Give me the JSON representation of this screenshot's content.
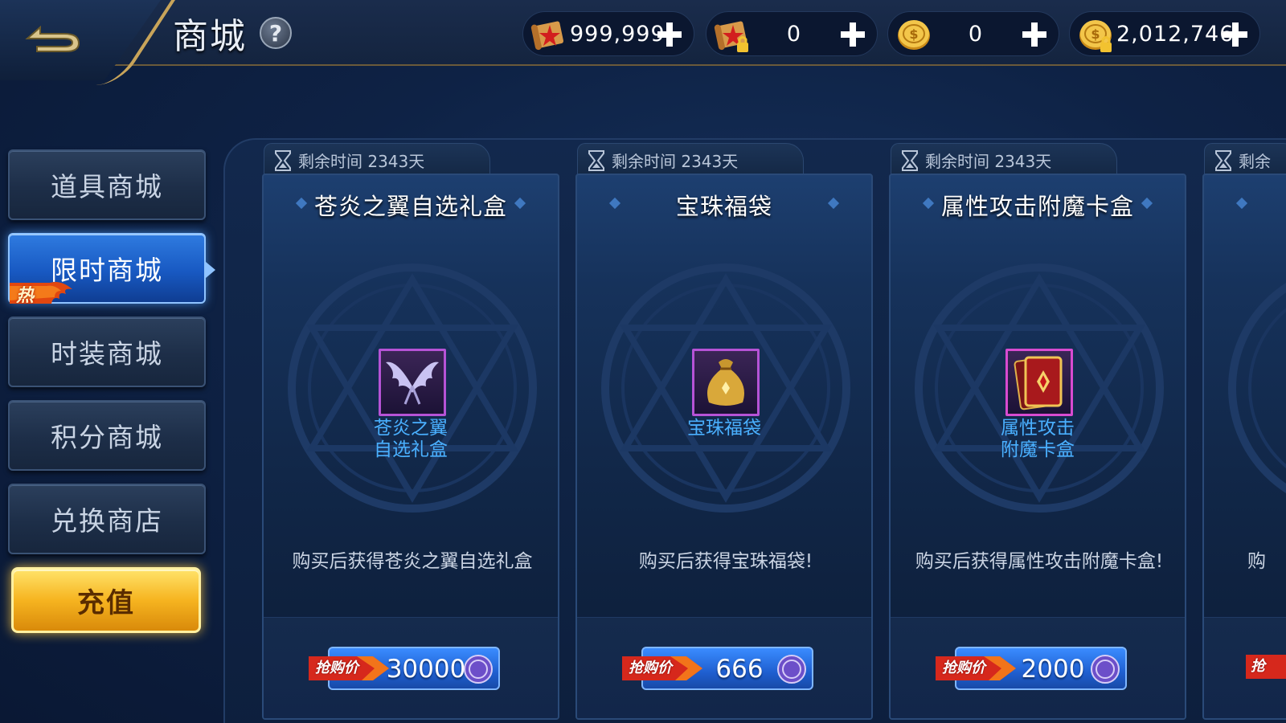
{
  "header": {
    "title": "商城",
    "help_label": "?"
  },
  "currencies": [
    {
      "icon": "red-scroll-icon",
      "value": "999,999"
    },
    {
      "icon": "locked-red-scroll-icon",
      "value": "0"
    },
    {
      "icon": "gold-coin-icon",
      "value": "0"
    },
    {
      "icon": "locked-gold-coin-icon",
      "value": "2,012,746"
    }
  ],
  "sidebar": {
    "items": [
      {
        "label": "道具商城",
        "active": false
      },
      {
        "label": "限时商城",
        "active": true,
        "badge": "热"
      },
      {
        "label": "时装商城",
        "active": false
      },
      {
        "label": "积分商城",
        "active": false
      },
      {
        "label": "兑换商店",
        "active": false
      }
    ],
    "recharge_label": "充值"
  },
  "cards": [
    {
      "timer": "剩余时间 2343天",
      "title": "苍炎之翼自选礼盒",
      "item_name_line1": "苍炎之翼",
      "item_name_line2": "自选礼盒",
      "item_icon": "wings-icon",
      "description": "购买后获得苍炎之翼自选礼盒",
      "price_tag": "抢购价",
      "price": "30000",
      "price_currency_icon": "points-coin-icon"
    },
    {
      "timer": "剩余时间 2343天",
      "title": "宝珠福袋",
      "item_name_line1": "宝珠福袋",
      "item_name_line2": "",
      "item_icon": "lucky-bag-icon",
      "description": "购买后获得宝珠福袋!",
      "price_tag": "抢购价",
      "price": "666",
      "price_currency_icon": "points-coin-icon"
    },
    {
      "timer": "剩余时间 2343天",
      "title": "属性攻击附魔卡盒",
      "item_name_line1": "属性攻击",
      "item_name_line2": "附魔卡盒",
      "item_icon": "enchant-card-box-icon",
      "description": "购买后获得属性攻击附魔卡盒!",
      "price_tag": "抢购价",
      "price": "2000",
      "price_currency_icon": "points-coin-icon"
    },
    {
      "timer": "剩余",
      "title": "",
      "item_name_line1": "",
      "item_name_line2": "",
      "item_icon": "",
      "description": "购",
      "price_tag": "抢",
      "price": "",
      "price_currency_icon": ""
    }
  ],
  "colors": {
    "accent_blue": "#2f7be0",
    "gold": "#f6b420",
    "item_name": "#4ab0ff",
    "rarity_purple": "#b653d6"
  }
}
